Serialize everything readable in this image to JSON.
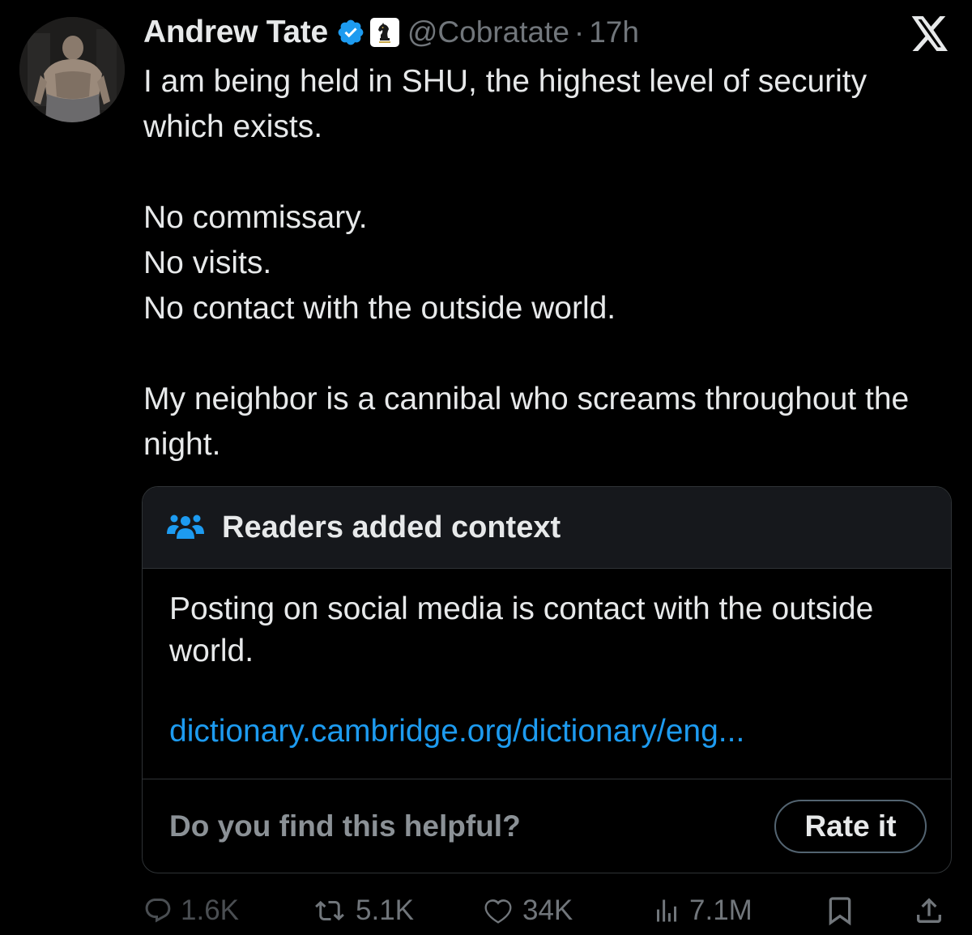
{
  "tweet": {
    "author_name": "Andrew Tate",
    "handle": "@Cobratate",
    "separator": "·",
    "time": "17h",
    "paragraphs": [
      [
        "I am being held in SHU, the highest level of security which exists."
      ],
      [
        "No commissary.",
        "No visits.",
        "No contact with the outside world."
      ],
      [
        "My neighbor is a cannibal who screams throughout the night."
      ]
    ]
  },
  "community_note": {
    "title": "Readers added context",
    "text": "Posting on social media is contact with the outside world.",
    "link": "dictionary.cambridge.org/dictionary/eng...",
    "question": "Do you find this helpful?",
    "rate_label": "Rate it"
  },
  "actions": {
    "replies": "1.6K",
    "retweets": "5.1K",
    "likes": "34K",
    "views": "7.1M"
  },
  "icons": {
    "verified": "verified-badge-icon",
    "affiliate": "chess-knight-affiliate-icon",
    "brand": "x-logo-icon",
    "note": "people-icon",
    "reply": "reply-icon",
    "retweet": "retweet-icon",
    "like": "heart-icon",
    "views": "views-icon",
    "bookmark": "bookmark-icon",
    "share": "share-icon"
  },
  "colors": {
    "background": "#000000",
    "text": "#e7e9ea",
    "muted": "#71767b",
    "accent": "#1d9bf0",
    "note_header": "#16181c",
    "border": "#2f3336"
  }
}
